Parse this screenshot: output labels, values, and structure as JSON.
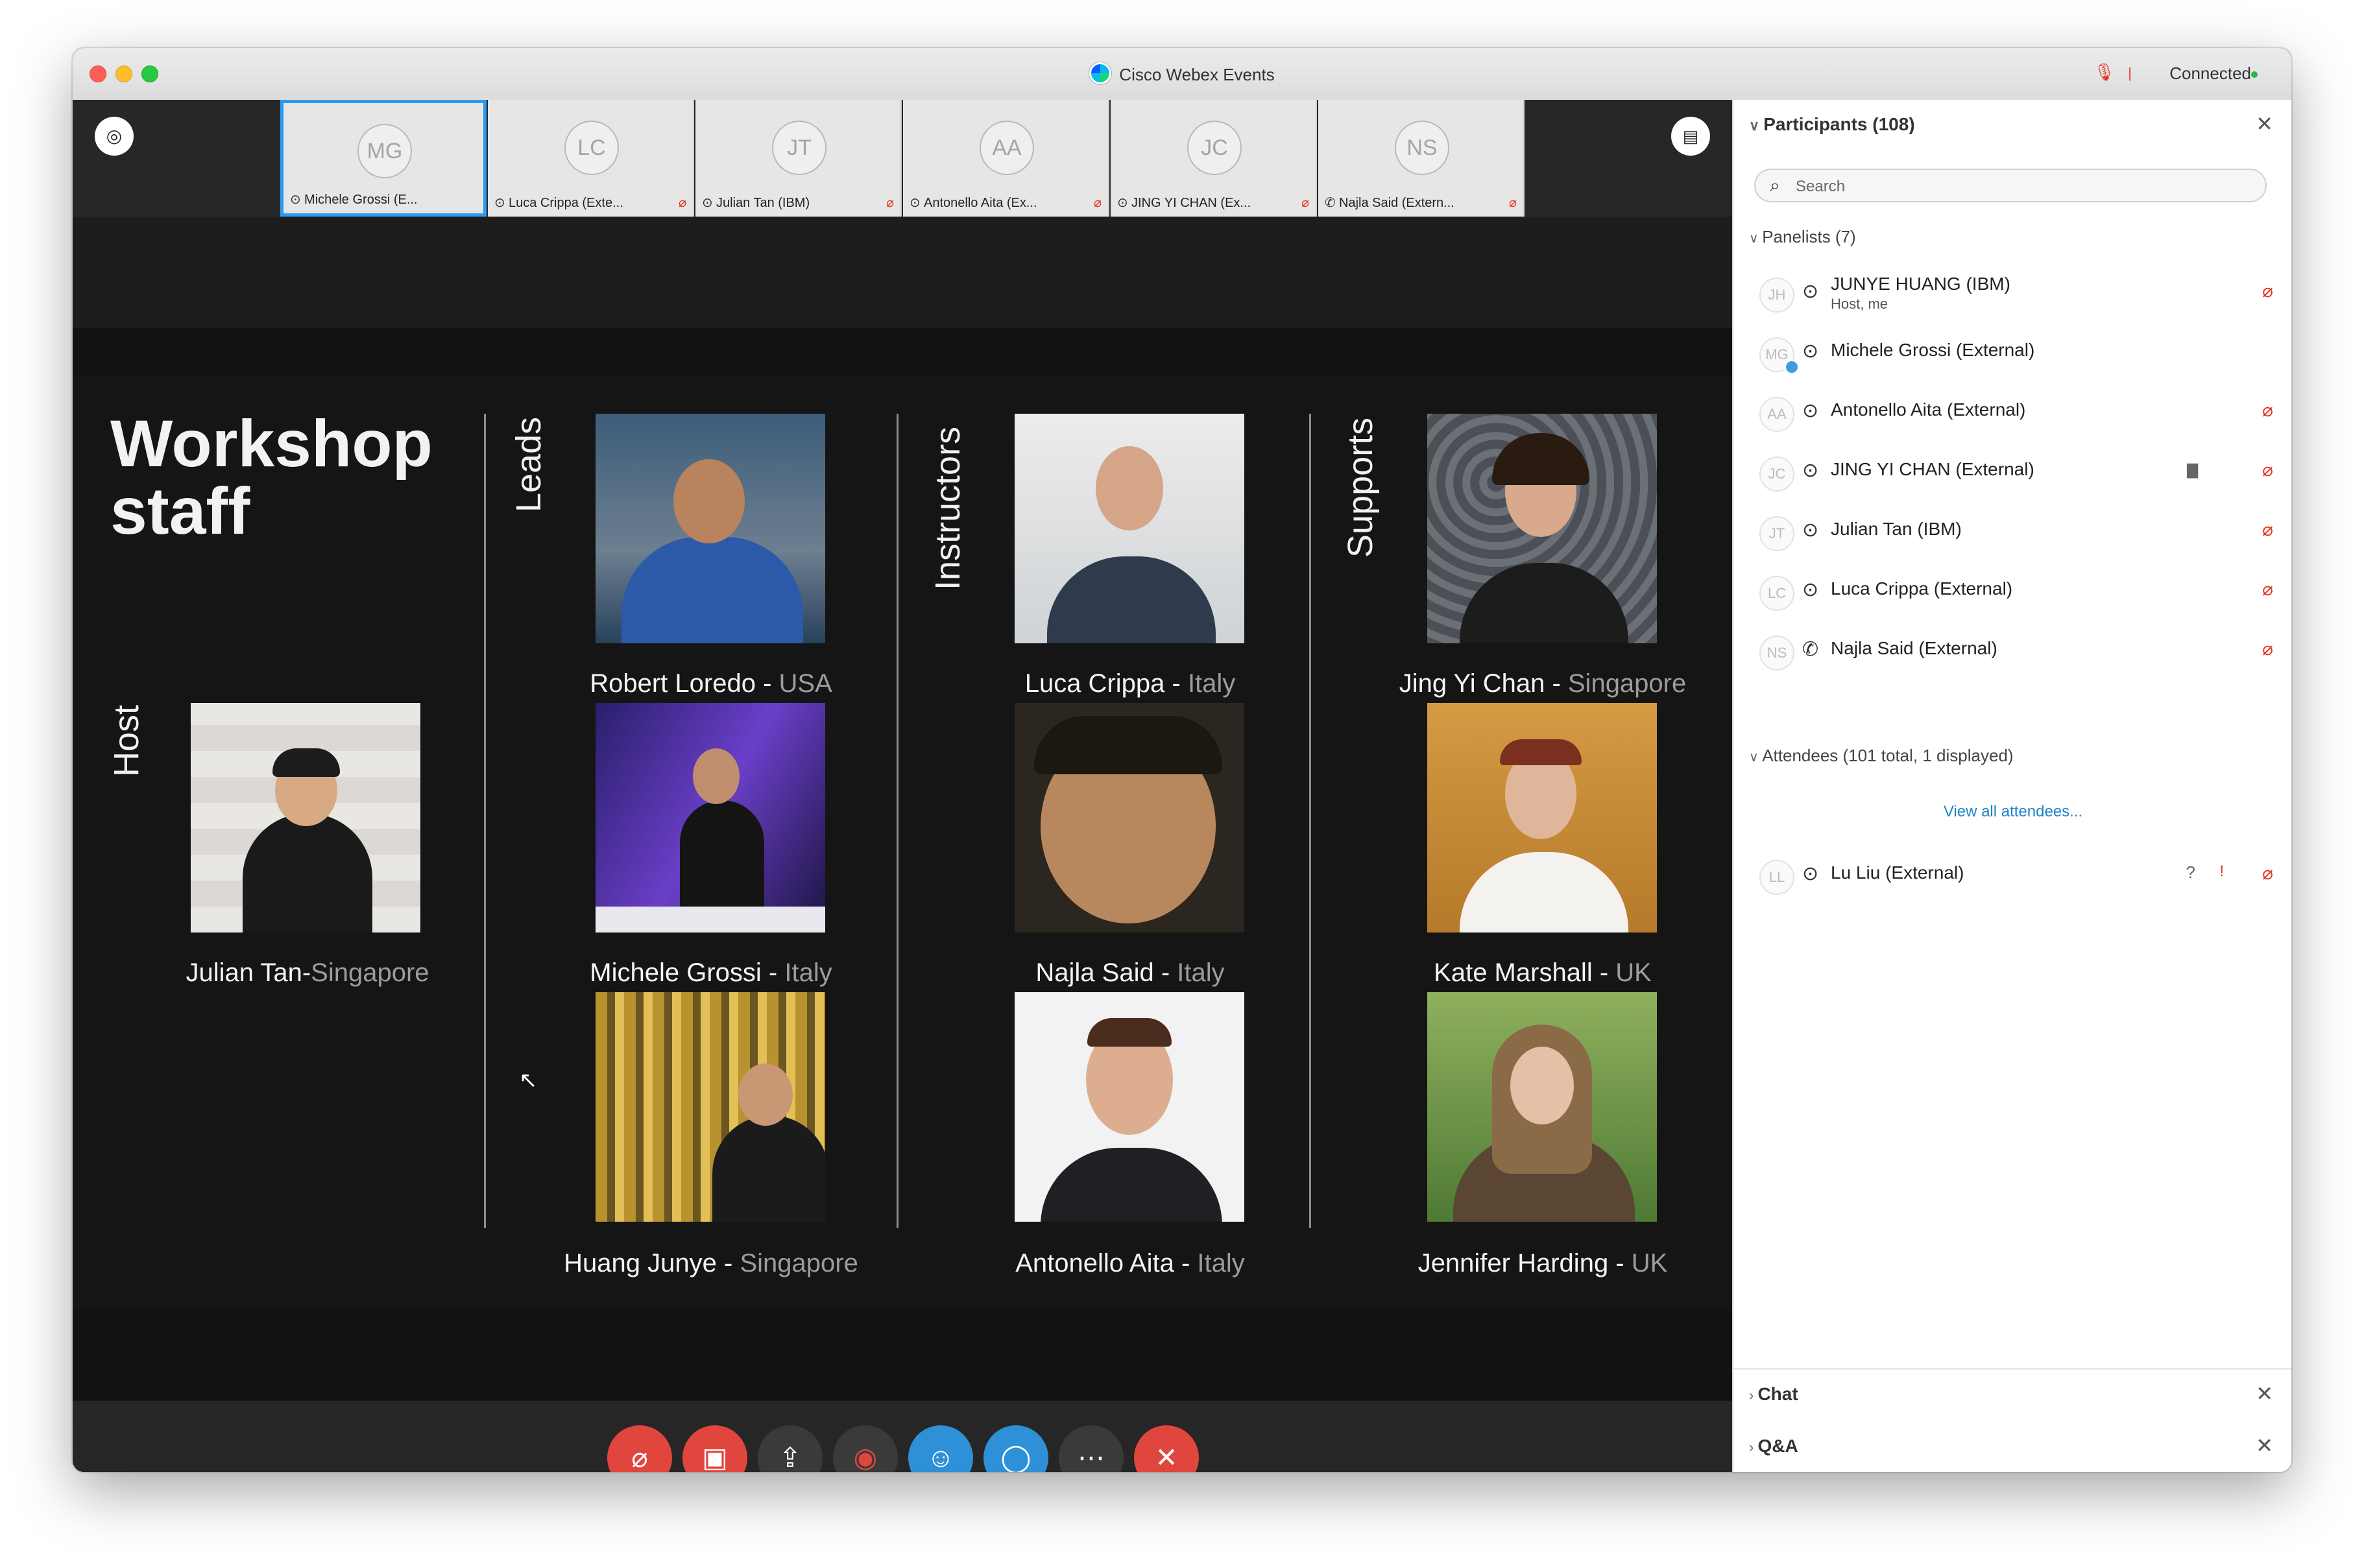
{
  "window": {
    "title": "Cisco Webex Events",
    "status": "Connected",
    "status_sep": "|",
    "mic_muted_icon": "mic-muted-icon"
  },
  "thumbnails": [
    {
      "initials": "MG",
      "name": "Michele Grossi (E...",
      "selected": true,
      "muted": false
    },
    {
      "initials": "LC",
      "name": "Luca Crippa (Exte...",
      "selected": false,
      "muted": true
    },
    {
      "initials": "JT",
      "name": "Julian Tan (IBM)",
      "selected": false,
      "muted": true
    },
    {
      "initials": "AA",
      "name": "Antonello Aita (Ex...",
      "selected": false,
      "muted": true
    },
    {
      "initials": "JC",
      "name": "JING YI CHAN (Ex...",
      "selected": false,
      "muted": true
    },
    {
      "initials": "NS",
      "name": "Najla Said (Extern...",
      "selected": false,
      "muted": true
    }
  ],
  "slide": {
    "title_line1": "Workshop",
    "title_line2": "staff",
    "host_label": "Host",
    "leads_label": "Leads",
    "instructors_label": "Instructors",
    "supports_label": "Supports",
    "people": [
      {
        "name": "Julian Tan-",
        "country": "Singapore"
      },
      {
        "name": "Robert Loredo - ",
        "country": "USA"
      },
      {
        "name": "Michele Grossi - ",
        "country": "Italy"
      },
      {
        "name": "Huang Junye - ",
        "country": "Singapore"
      },
      {
        "name": "Luca Crippa - ",
        "country": "Italy"
      },
      {
        "name": "Najla Said - ",
        "country": "Italy"
      },
      {
        "name": "Antonello Aita - ",
        "country": "Italy"
      },
      {
        "name": "Jing Yi Chan - ",
        "country": "Singapore"
      },
      {
        "name": "Kate Marshall - ",
        "country": "UK"
      },
      {
        "name": "Jennifer Harding - ",
        "country": "UK"
      }
    ]
  },
  "toolbar": {
    "buttons": [
      "mute-button",
      "stop-video-button",
      "share-button",
      "record-button",
      "participants-button",
      "chat-button",
      "more-options-button",
      "leave-button"
    ]
  },
  "panel": {
    "title": "Participants (108)",
    "search_placeholder": "Search",
    "panelists_header": "Panelists (7)",
    "panelists": [
      {
        "initials": "JH",
        "name": "JUNYE HUANG (IBM)",
        "sub": "Host, me",
        "muted": true,
        "audio": "headset"
      },
      {
        "initials": "MG",
        "name": "Michele Grossi (External)",
        "sub": "",
        "muted": false,
        "audio": "headset"
      },
      {
        "initials": "AA",
        "name": "Antonello Aita (External)",
        "sub": "",
        "muted": true,
        "audio": "headset"
      },
      {
        "initials": "JC",
        "name": "JING YI CHAN (External)",
        "sub": "",
        "muted": true,
        "audio": "headset"
      },
      {
        "initials": "JT",
        "name": "Julian Tan (IBM)",
        "sub": "",
        "muted": true,
        "audio": "headset"
      },
      {
        "initials": "LC",
        "name": "Luca Crippa (External)",
        "sub": "",
        "muted": true,
        "audio": "headset"
      },
      {
        "initials": "NS",
        "name": "Najla Said (External)",
        "sub": "",
        "muted": true,
        "audio": "phone"
      }
    ],
    "attendees_header": "Attendees (101 total, 1 displayed)",
    "view_all": "View all attendees...",
    "attendees": [
      {
        "initials": "LL",
        "name": "Lu Liu (External)",
        "question": "?",
        "alert": "!"
      }
    ],
    "chat_label": "Chat",
    "qa_label": "Q&A",
    "alert_label": "!"
  },
  "colors": {
    "accent": "#2d9bf0",
    "mute_red": "#e2341d",
    "end_red": "#e0463d",
    "blue_button": "#2e90d6"
  }
}
